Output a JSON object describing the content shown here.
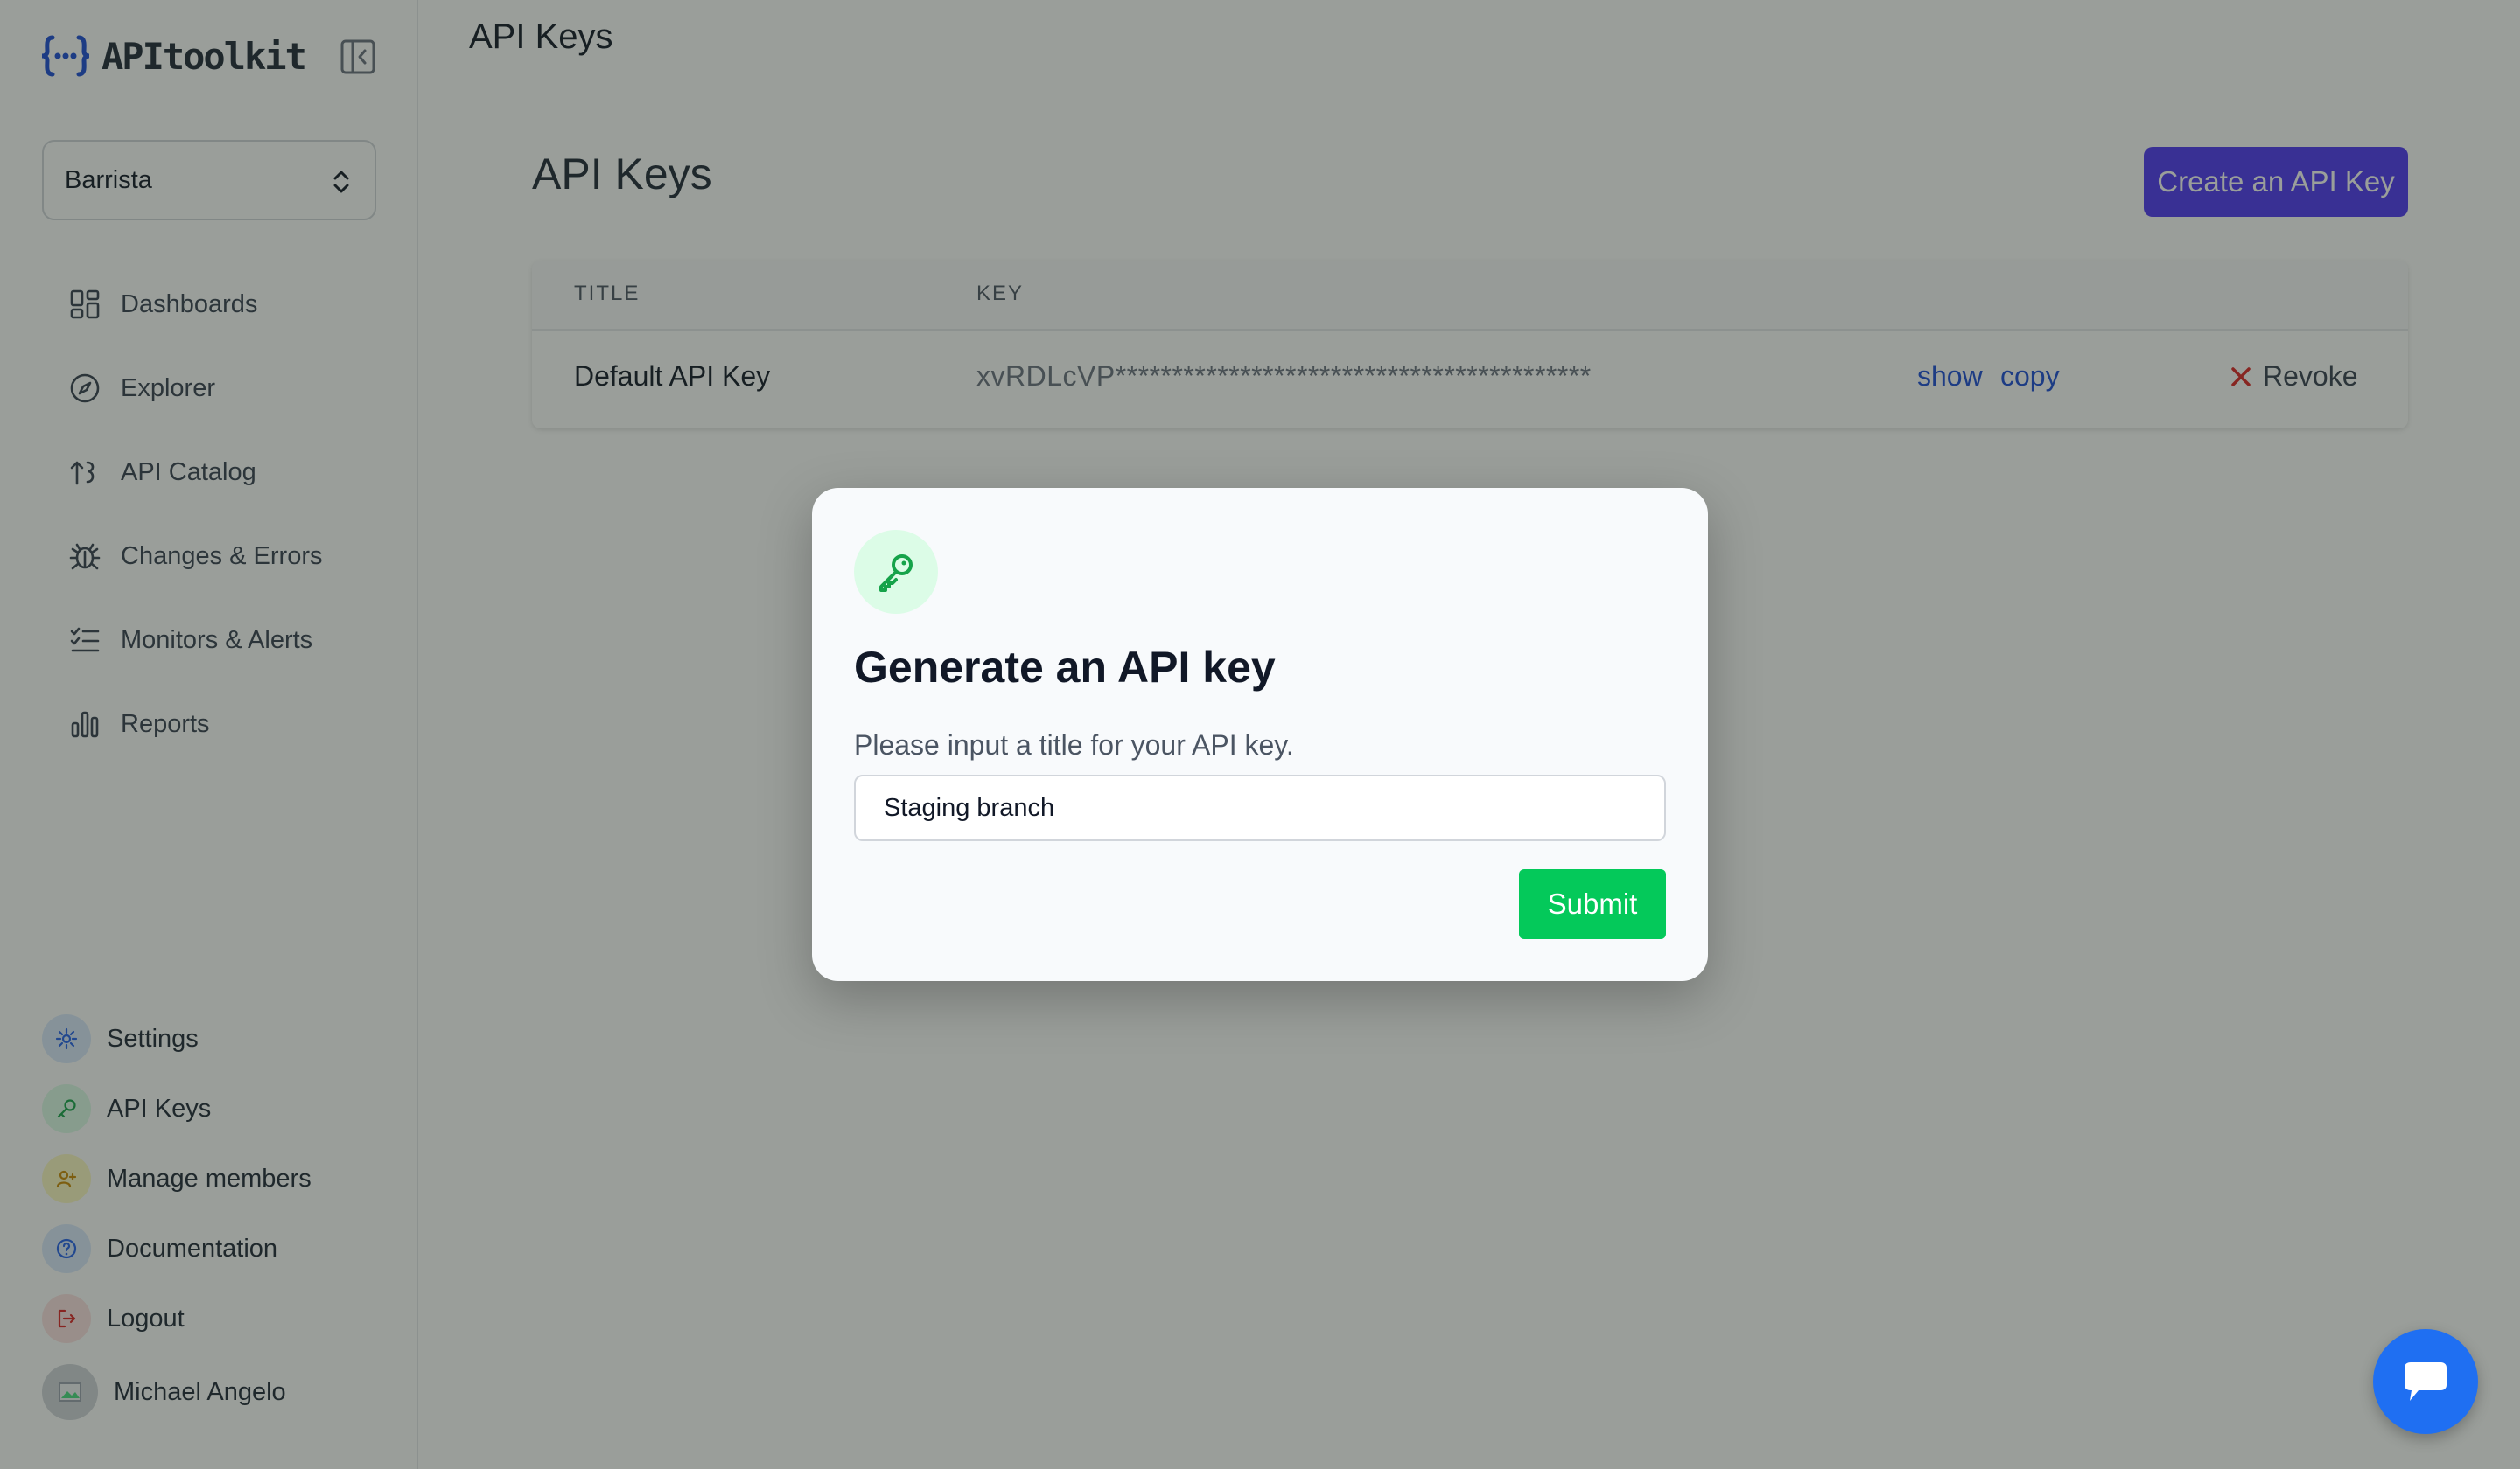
{
  "app": {
    "brand_name": "APItoolkit",
    "project_selector": "Barrista"
  },
  "sidebar": {
    "nav": [
      {
        "label": "Dashboards",
        "icon": "dashboard-icon"
      },
      {
        "label": "Explorer",
        "icon": "compass-icon"
      },
      {
        "label": "API Catalog",
        "icon": "catalog-icon"
      },
      {
        "label": "Changes & Errors",
        "icon": "bug-icon"
      },
      {
        "label": "Monitors & Alerts",
        "icon": "list-check-icon"
      },
      {
        "label": "Reports",
        "icon": "bar-chart-icon"
      }
    ],
    "bottom": [
      {
        "label": "Settings",
        "icon": "gear-icon",
        "color": "#2563eb",
        "bg": "#dbeafe"
      },
      {
        "label": "API Keys",
        "icon": "key-icon",
        "color": "#16a34a",
        "bg": "#dcfce7"
      },
      {
        "label": "Manage members",
        "icon": "add-user-icon",
        "color": "#ca8a04",
        "bg": "#fef9c3"
      },
      {
        "label": "Documentation",
        "icon": "help-icon",
        "color": "#2563eb",
        "bg": "#dbeafe"
      },
      {
        "label": "Logout",
        "icon": "logout-icon",
        "color": "#dc2626",
        "bg": "#fee2e2"
      }
    ],
    "user_name": "Michael Angelo"
  },
  "main": {
    "topbar_title": "API Keys",
    "page_title": "API Keys",
    "create_button": "Create an API Key",
    "table": {
      "columns": [
        "TITLE",
        "KEY"
      ],
      "rows": [
        {
          "title": "Default API Key",
          "key": "xvRDLcVP******************************************",
          "show_label": "show",
          "copy_label": "copy",
          "revoke_label": "Revoke"
        }
      ]
    }
  },
  "modal": {
    "title": "Generate an API key",
    "description": "Please input a title for your API key.",
    "input_value": "Staging branch",
    "submit_label": "Submit"
  },
  "colors": {
    "primary": "#4f37f5",
    "success": "#04c95a",
    "link": "#1d4ed8",
    "danger": "#dc2626",
    "chat": "#1f6ff2"
  }
}
